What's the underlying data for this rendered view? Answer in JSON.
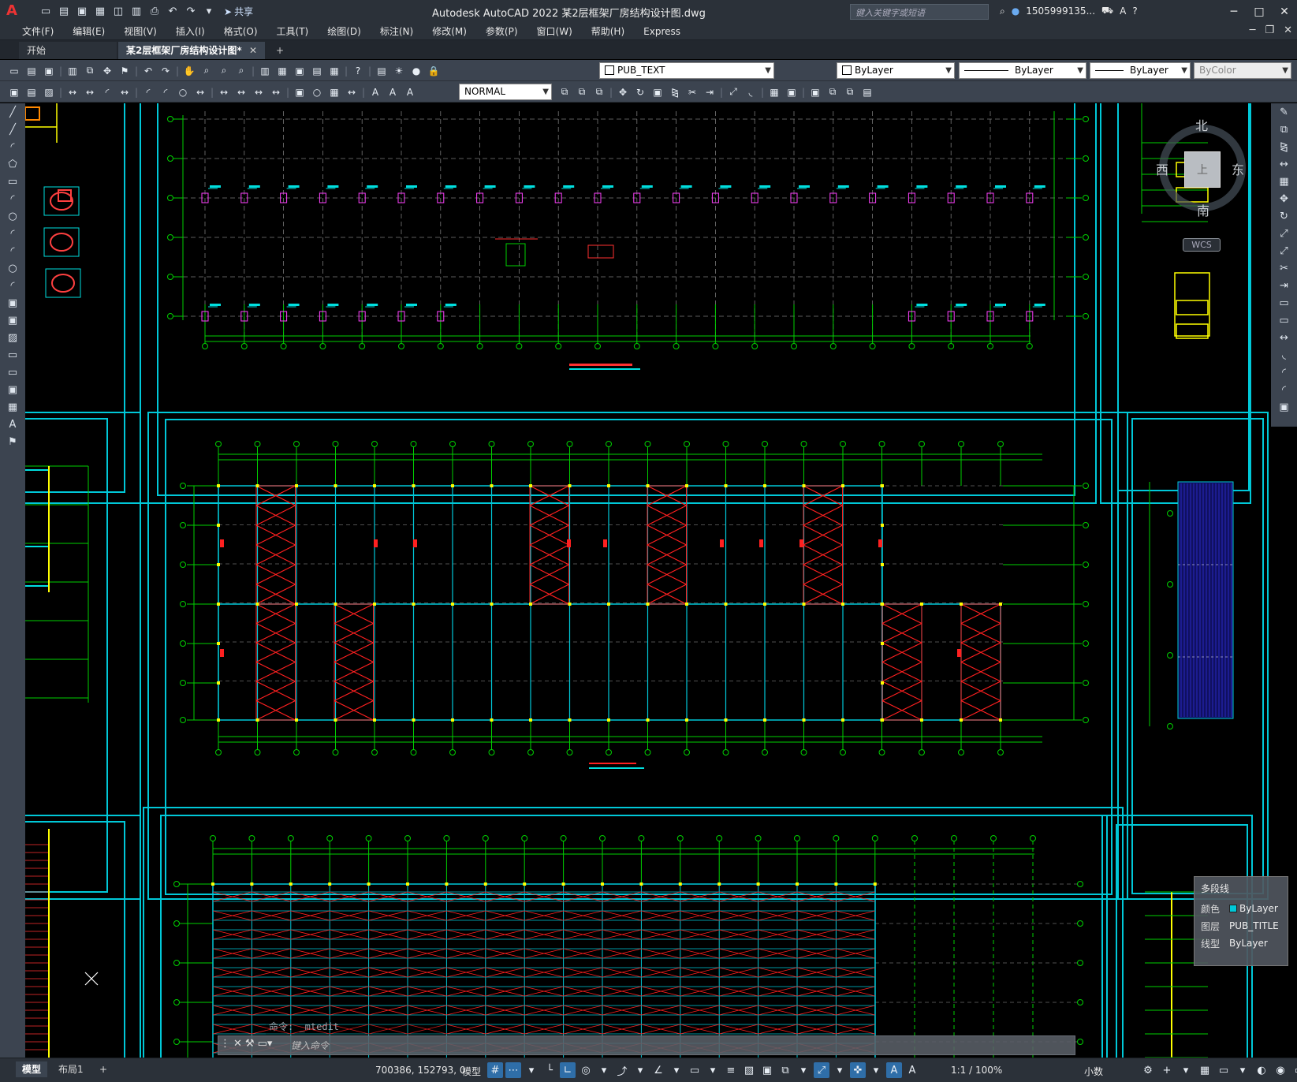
{
  "titlebar": {
    "app_title": "Autodesk AutoCAD 2022    某2层框架厂房结构设计图.dwg",
    "share_label": "共享",
    "search_placeholder": "键入关键字或短语",
    "user_label": "1505999135...",
    "qat_icons": [
      "new-icon",
      "open-icon",
      "save-icon",
      "saveas-icon",
      "web-icon",
      "publish-icon",
      "print-icon",
      "undo-icon",
      "redo-icon",
      "customize-icon"
    ]
  },
  "menubar": {
    "items": [
      "文件(F)",
      "编辑(E)",
      "视图(V)",
      "插入(I)",
      "格式(O)",
      "工具(T)",
      "绘图(D)",
      "标注(N)",
      "修改(M)",
      "参数(P)",
      "窗口(W)",
      "帮助(H)",
      "Express"
    ]
  },
  "tabs": {
    "start": "开始",
    "active_doc": "某2层框架厂房结构设计图*",
    "add": "+"
  },
  "toolbar": {
    "layer": "PUB_TEXT",
    "color": "ByLayer",
    "linetype": "ByLayer",
    "lineweight": "ByLayer",
    "plotstyle": "ByColor",
    "visual_style": "NORMAL"
  },
  "viewcube": {
    "north": "北",
    "south": "南",
    "east": "东",
    "west": "西",
    "top": "上",
    "ucs": "WCS"
  },
  "quick_properties": {
    "title": "多段线",
    "rows": [
      {
        "key": "颜色",
        "value": "ByLayer"
      },
      {
        "key": "图层",
        "value": "PUB_TITLE"
      },
      {
        "key": "线型",
        "value": "ByLayer"
      }
    ]
  },
  "command": {
    "history": "命令:  _mtedit",
    "placeholder": "键入命令"
  },
  "statusbar": {
    "model_tab": "模型",
    "layout_tab": "布局1",
    "add_tab": "+",
    "coordinates": "700386, 152793, 0",
    "model_space": "模型",
    "annotation_scale": "1:1 / 100%",
    "units": "小数"
  },
  "colors": {
    "frame": "#00c8d8",
    "grid": "#00d000",
    "bracing": "#ff2020",
    "column": "#ffff00",
    "dim": "#00e0e0",
    "axis_bubble": "#00d000"
  }
}
